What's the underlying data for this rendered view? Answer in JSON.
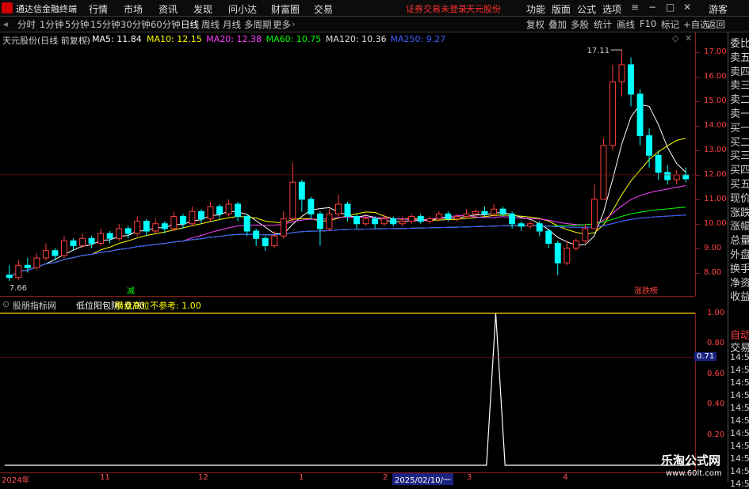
{
  "app": {
    "title": "通达信金融终端"
  },
  "menu": [
    "行情",
    "市场",
    "资讯",
    "发现",
    "问小达",
    "财富圈",
    "交易"
  ],
  "warning": {
    "text1": "证券交易未登录",
    "text2": "天元股份"
  },
  "right_menu": [
    "功能",
    "版面",
    "公式",
    "选项",
    "游客"
  ],
  "periods": [
    "分时",
    "1分钟",
    "5分钟",
    "15分钟",
    "30分钟",
    "60分钟",
    "日线",
    "周线",
    "月线",
    "多周期",
    "更多"
  ],
  "active_period": "日线",
  "toolbar_right": [
    "复权",
    "叠加",
    "多股",
    "统计",
    "画线",
    "F10",
    "标记",
    "+自选",
    "返回"
  ],
  "stock": {
    "name_label": "天元股份(日线 前复权)"
  },
  "ma": [
    {
      "label": "MA5: 11.84",
      "color": "#ffffff"
    },
    {
      "label": "MA10: 12.15",
      "color": "#ffff00"
    },
    {
      "label": "MA20: 12.38",
      "color": "#ff40ff"
    },
    {
      "label": "MA60: 10.75",
      "color": "#00ff00"
    },
    {
      "label": "MA120: 10.36",
      "color": "#e0e0e0"
    },
    {
      "label": "MA250: 9.27",
      "color": "#4060ff"
    }
  ],
  "price_axis": [
    "17.00",
    "16.00",
    "15.00",
    "14.00",
    "13.00",
    "12.00",
    "11.00",
    "10.00",
    "9.00",
    "8.00"
  ],
  "annotations": {
    "high": "17.11",
    "low": "7.66",
    "bottom_left_tag": "减",
    "bottom_right_tag": "涨跌榜"
  },
  "indicator": {
    "name": "股朋指标网",
    "line1": "低位阳包阴: 0.00",
    "line2": "横盘高位不参考: 1.00",
    "axis": [
      "1.00",
      "0.80",
      "0.60",
      "0.40",
      "0.20"
    ],
    "cursor_value": "0.71"
  },
  "x_axis": [
    "2024年",
    "11",
    "12",
    "1",
    "2",
    "2025/02/10/一",
    "3",
    "4"
  ],
  "sidebar_top": [
    "委比",
    "卖五",
    "卖四",
    "卖三",
    "卖二",
    "卖一",
    "买一",
    "买二",
    "买三",
    "买四",
    "买五",
    "现价",
    "涨跌",
    "涨幅",
    "总量",
    "外盘",
    "换手",
    "净资",
    "收益"
  ],
  "sidebar_bottom": [
    "自动",
    "交易",
    "14:56",
    "14:56",
    "14:56",
    "14:56",
    "14:56",
    "14:56",
    "14:56",
    "14:56",
    "14:56",
    "14:56",
    "14:56"
  ],
  "watermark": {
    "name": "乐淘公式网",
    "url": "www.60lt.com"
  },
  "chart_data": {
    "type": "candlestick",
    "ylim": [
      7.5,
      17.5
    ],
    "candles": [
      [
        7.9,
        7.8,
        8.3,
        7.66
      ],
      [
        7.8,
        8.3,
        8.5,
        7.7
      ],
      [
        8.3,
        8.2,
        8.6,
        8.0
      ],
      [
        8.2,
        8.6,
        8.8,
        8.1
      ],
      [
        8.6,
        8.9,
        9.2,
        8.5
      ],
      [
        8.9,
        8.7,
        9.0,
        8.5
      ],
      [
        8.7,
        9.3,
        9.5,
        8.6
      ],
      [
        9.3,
        9.1,
        9.4,
        8.9
      ],
      [
        9.1,
        9.4,
        9.6,
        9.0
      ],
      [
        9.4,
        9.2,
        9.5,
        9.0
      ],
      [
        9.2,
        9.6,
        9.8,
        9.1
      ],
      [
        9.6,
        9.4,
        9.7,
        9.2
      ],
      [
        9.4,
        9.8,
        10.0,
        9.3
      ],
      [
        9.8,
        9.6,
        9.9,
        9.4
      ],
      [
        9.6,
        10.1,
        10.3,
        9.5
      ],
      [
        10.1,
        9.7,
        10.2,
        9.5
      ],
      [
        9.7,
        10.0,
        10.2,
        9.6
      ],
      [
        10.0,
        9.8,
        10.1,
        9.6
      ],
      [
        9.8,
        10.3,
        10.5,
        9.7
      ],
      [
        10.3,
        10.0,
        10.4,
        9.8
      ],
      [
        10.0,
        10.5,
        10.7,
        9.9
      ],
      [
        10.5,
        10.2,
        10.6,
        10.0
      ],
      [
        10.2,
        10.7,
        10.9,
        10.1
      ],
      [
        10.7,
        10.4,
        10.8,
        10.2
      ],
      [
        10.4,
        10.8,
        11.0,
        10.3
      ],
      [
        10.8,
        10.3,
        10.9,
        10.1
      ],
      [
        10.3,
        9.7,
        10.4,
        9.5
      ],
      [
        9.7,
        9.4,
        9.8,
        9.1
      ],
      [
        9.4,
        9.1,
        9.5,
        8.9
      ],
      [
        9.1,
        9.5,
        9.7,
        9.0
      ],
      [
        9.5,
        10.2,
        10.5,
        9.4
      ],
      [
        10.2,
        11.7,
        12.5,
        10.1
      ],
      [
        11.7,
        11.0,
        11.8,
        10.5
      ],
      [
        11.0,
        10.4,
        11.1,
        10.2
      ],
      [
        10.4,
        9.8,
        10.5,
        9.1
      ],
      [
        9.8,
        10.4,
        10.6,
        9.7
      ],
      [
        10.4,
        10.8,
        11.2,
        10.3
      ],
      [
        10.8,
        10.3,
        10.9,
        10.1
      ],
      [
        10.3,
        10.0,
        10.4,
        9.8
      ],
      [
        10.0,
        10.2,
        10.4,
        9.9
      ],
      [
        10.2,
        10.0,
        10.3,
        9.8
      ],
      [
        10.0,
        10.2,
        10.4,
        9.9
      ],
      [
        10.2,
        10.0,
        10.3,
        9.9
      ],
      [
        10.0,
        10.1,
        10.3,
        9.9
      ],
      [
        10.1,
        10.3,
        10.4,
        10.0
      ],
      [
        10.3,
        10.1,
        10.4,
        10.0
      ],
      [
        10.1,
        10.2,
        10.3,
        10.0
      ],
      [
        10.2,
        10.4,
        10.5,
        10.1
      ],
      [
        10.4,
        10.2,
        10.5,
        10.1
      ],
      [
        10.2,
        10.3,
        10.4,
        10.1
      ],
      [
        10.3,
        10.4,
        10.6,
        10.2
      ],
      [
        10.4,
        10.5,
        10.6,
        10.3
      ],
      [
        10.5,
        10.4,
        10.7,
        10.3
      ],
      [
        10.4,
        10.6,
        10.8,
        10.3
      ],
      [
        10.6,
        10.4,
        10.7,
        10.3
      ],
      [
        10.4,
        10.0,
        10.5,
        9.8
      ],
      [
        10.0,
        9.9,
        10.1,
        9.7
      ],
      [
        9.9,
        10.0,
        10.1,
        9.8
      ],
      [
        10.0,
        9.7,
        10.1,
        9.5
      ],
      [
        9.7,
        9.2,
        9.8,
        9.0
      ],
      [
        9.2,
        8.4,
        9.3,
        7.9
      ],
      [
        8.4,
        9.0,
        9.3,
        8.3
      ],
      [
        9.0,
        9.3,
        9.4,
        8.9
      ],
      [
        9.3,
        9.8,
        10.0,
        9.2
      ],
      [
        9.8,
        11.0,
        11.6,
        9.8
      ],
      [
        11.0,
        13.2,
        13.5,
        11.0
      ],
      [
        13.2,
        15.8,
        16.5,
        13.0
      ],
      [
        15.8,
        16.5,
        17.11,
        15.2
      ],
      [
        16.5,
        15.3,
        16.8,
        14.8
      ],
      [
        15.3,
        13.6,
        15.5,
        13.2
      ],
      [
        13.6,
        12.8,
        13.9,
        12.3
      ],
      [
        12.8,
        12.1,
        13.0,
        11.8
      ],
      [
        12.1,
        11.8,
        12.4,
        11.6
      ],
      [
        11.8,
        12.0,
        12.2,
        11.6
      ],
      [
        12.0,
        11.84,
        12.3,
        11.7
      ]
    ],
    "indicator_series": [
      0,
      0,
      0,
      0,
      0,
      0,
      0,
      0,
      0,
      0,
      0,
      0,
      0,
      0,
      0,
      0,
      0,
      0,
      0,
      0,
      0,
      0,
      0,
      0,
      0,
      0,
      0,
      0,
      0,
      0,
      0,
      0,
      0,
      0,
      0,
      0,
      0,
      0,
      0,
      0,
      0,
      0,
      0,
      0,
      0,
      0,
      0,
      0,
      0,
      0,
      0,
      0,
      0,
      1,
      0,
      0,
      0,
      0,
      0,
      0,
      0,
      0,
      0,
      0,
      0,
      0,
      0,
      0,
      0,
      0,
      0,
      0,
      0,
      0,
      0
    ]
  }
}
